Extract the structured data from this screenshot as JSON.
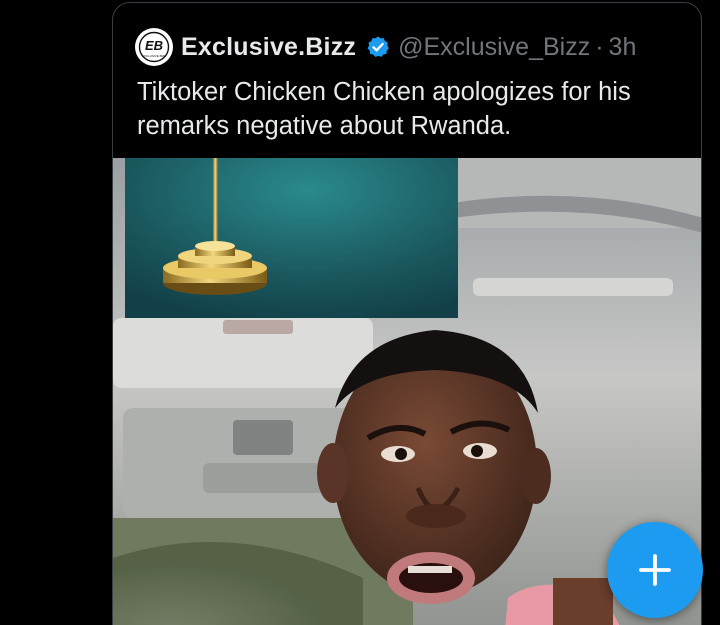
{
  "tweet": {
    "display_name": "Exclusive.Bizz",
    "handle": "@Exclusive_Bizz",
    "separator": "·",
    "time": "3h",
    "text": "Tiktoker Chicken Chicken apologizes for his remarks negative about Rwanda.",
    "verified": true
  },
  "avatar": {
    "logo_text": "EB",
    "logo_subtext": "EXCLUSIVE BIZZ"
  },
  "fab": {
    "icon": "plus-icon"
  },
  "colors": {
    "background": "#000000",
    "card_border": "#3a3f44",
    "primary_text": "#e7e9ea",
    "secondary_text": "#71767b",
    "accent_blue": "#1d9bf0",
    "panel_teal": "#1d5b61"
  }
}
